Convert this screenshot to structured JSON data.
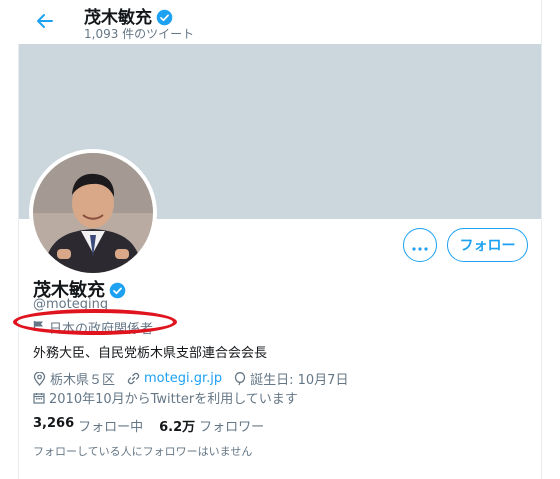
{
  "header": {
    "name": "茂木敏充",
    "tweet_count": "1,093 件のツイート"
  },
  "profile": {
    "name": "茂木敏充",
    "handle": "@moteging",
    "label": "日本の政府関係者",
    "bio": "外務大臣、自民党栃木県支部連合会会長",
    "location": "栃木県５区",
    "website": "motegi.gr.jp",
    "birthday": "誕生日: 10月7日",
    "joined": "2010年10月からTwitterを利用しています"
  },
  "stats": {
    "following_count": "3,266",
    "following_label": "フォロー中",
    "followers_count": "6.2万",
    "followers_label": "フォロワー"
  },
  "followers_note": "フォローしている人にフォロワーはいません",
  "buttons": {
    "follow_label": "フォロー"
  },
  "colors": {
    "accent": "#1da1f2",
    "banner": "#ccd6dd",
    "highlight": "#e0141e"
  },
  "icons": [
    "back-arrow-icon",
    "verified-badge-icon",
    "flag-icon",
    "location-icon",
    "link-icon",
    "balloon-icon",
    "calendar-icon",
    "more-icon"
  ]
}
